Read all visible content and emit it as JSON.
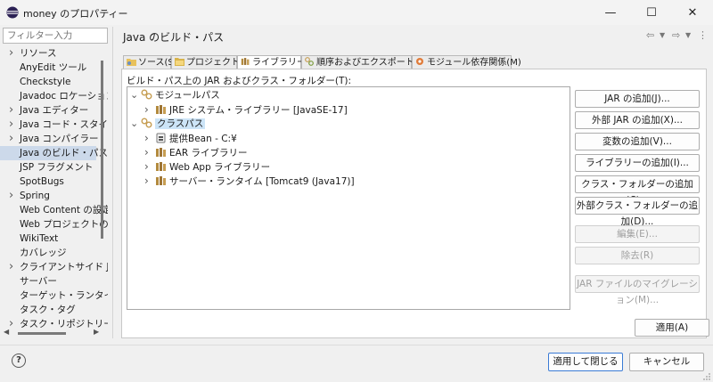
{
  "window": {
    "title": "money のプロパティー",
    "minimize": "—",
    "maximize": "☐",
    "close": "✕"
  },
  "filter": {
    "placeholder": "フィルター入力"
  },
  "nav": {
    "items": [
      {
        "label": "リソース",
        "expandable": true
      },
      {
        "label": "AnyEdit ツール",
        "expandable": false
      },
      {
        "label": "Checkstyle",
        "expandable": false
      },
      {
        "label": "Javadoc ロケーション",
        "expandable": false
      },
      {
        "label": "Java エディター",
        "expandable": true
      },
      {
        "label": "Java コード・スタイル",
        "expandable": true
      },
      {
        "label": "Java コンパイラー",
        "expandable": true
      },
      {
        "label": "Java のビルド・パス",
        "expandable": false,
        "selected": true
      },
      {
        "label": "JSP フラグメント",
        "expandable": false
      },
      {
        "label": "SpotBugs",
        "expandable": false
      },
      {
        "label": "Spring",
        "expandable": true
      },
      {
        "label": "Web Content の設定",
        "expandable": false
      },
      {
        "label": "Web プロジェクトの設定",
        "expandable": false
      },
      {
        "label": "WikiText",
        "expandable": false
      },
      {
        "label": "カバレッジ",
        "expandable": false
      },
      {
        "label": "クライアントサイド Java",
        "expandable": true
      },
      {
        "label": "サーバー",
        "expandable": false
      },
      {
        "label": "ターゲット・ランタイム",
        "expandable": false
      },
      {
        "label": "タスク・タグ",
        "expandable": false
      },
      {
        "label": "タスク・リポジトリー",
        "expandable": true
      }
    ]
  },
  "header": {
    "title": "Java のビルド・パス",
    "back_icon": "⇦",
    "forward_icon": "⇨",
    "menu_icon": "⋮"
  },
  "tabs": [
    {
      "label": "ソース(S)",
      "active": false,
      "icon": "source-folder-icon"
    },
    {
      "label": "プロジェクト(P)",
      "active": false,
      "icon": "project-icon"
    },
    {
      "label": "ライブラリー(L)",
      "active": true,
      "icon": "library-icon"
    },
    {
      "label": "順序およびエクスポート(O)",
      "active": false,
      "icon": "order-export-icon"
    },
    {
      "label": "モジュール依存関係(M)",
      "active": false,
      "icon": "module-dependency-icon"
    }
  ],
  "tree": {
    "label": "ビルド・パス上の JAR およびクラス・フォルダー(T):",
    "nodes": [
      {
        "label": "モジュールパス",
        "level": 0,
        "expanded": true,
        "icon": "module-path-icon"
      },
      {
        "label": "JRE システム・ライブラリー [JavaSE-17]",
        "level": 1,
        "expanded": false,
        "icon": "library-icon"
      },
      {
        "label": "クラスパス",
        "level": 0,
        "expanded": true,
        "icon": "classpath-icon",
        "selected": true
      },
      {
        "label": "提供Bean - C:¥",
        "level": 1,
        "expanded": false,
        "icon": "jar-icon"
      },
      {
        "label": "EAR ライブラリー",
        "level": 1,
        "expanded": false,
        "icon": "library-icon"
      },
      {
        "label": "Web App ライブラリー",
        "level": 1,
        "expanded": false,
        "icon": "library-icon"
      },
      {
        "label": "サーバー・ランタイム [Tomcat9 (Java17)]",
        "level": 1,
        "expanded": false,
        "icon": "library-icon"
      }
    ]
  },
  "buttons": {
    "add_jar": "JAR の追加(J)...",
    "add_external_jar": "外部 JAR の追加(X)...",
    "add_variable": "変数の追加(V)...",
    "add_library": "ライブラリーの追加(I)...",
    "add_class_folder": "クラス・フォルダーの追加(C)...",
    "add_external_class_folder": "外部クラス・フォルダーの追加(D)...",
    "edit": "編集(E)...",
    "remove": "除去(R)",
    "migrate_jar": "JAR ファイルのマイグレーション(M)...",
    "apply": "適用(A)"
  },
  "footer": {
    "help": "?",
    "apply_close": "適用して閉じる",
    "cancel": "キャンセル"
  },
  "colors": {
    "selection": "#ccd9ea",
    "tree_selection": "#cce4f7",
    "default_button_border": "#3a7bd5"
  }
}
